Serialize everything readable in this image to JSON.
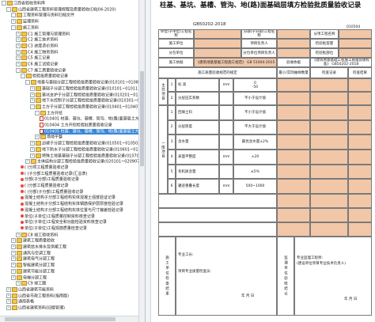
{
  "tree": {
    "items": [
      {
        "label": "江西省验收资料库",
        "indent": 0,
        "icon": "folder",
        "toggle": "-"
      },
      {
        "label": "山西省建筑工程资料管理规程及质量验收(DBJ04-2020)",
        "indent": 1,
        "icon": "folder",
        "toggle": "-"
      },
      {
        "label": "工程资料管理与资料归档文件",
        "indent": 2,
        "icon": "folder",
        "toggle": "-"
      },
      {
        "label": "监理资料",
        "indent": 2,
        "icon": "folder",
        "toggle": "+"
      },
      {
        "label": "施工资料",
        "indent": 2,
        "icon": "folder",
        "toggle": "-"
      },
      {
        "label": "C1 施工管理与管理资料",
        "indent": 3,
        "icon": "folder",
        "toggle": "+"
      },
      {
        "label": "C2 施工技术资料",
        "indent": 3,
        "icon": "folder",
        "toggle": "+"
      },
      {
        "label": "C3 进度造价资料",
        "indent": 3,
        "icon": "folder",
        "toggle": "+"
      },
      {
        "label": "C4 施工物资资料",
        "indent": 3,
        "icon": "folder",
        "toggle": "+"
      },
      {
        "label": "C5 施工记录",
        "indent": 3,
        "icon": "folder",
        "toggle": "+"
      },
      {
        "label": "C6 施工试验记录",
        "indent": 3,
        "icon": "folder",
        "toggle": "+"
      },
      {
        "label": "C7 施工质量验收记录",
        "indent": 3,
        "icon": "folder",
        "toggle": "-"
      },
      {
        "label": "检验批质量验收记录",
        "indent": 4,
        "icon": "folder",
        "toggle": "-"
      },
      {
        "label": "地基与基础分部工程检验批质量验收记录(010101~010801)",
        "indent": 5,
        "icon": "folder",
        "toggle": "-"
      },
      {
        "label": "基础子分部工程检验批质量验收记录(010101~010113)",
        "indent": 6,
        "icon": "folder",
        "toggle": "+"
      },
      {
        "label": "基坑支护子分部工程检验批质量验收记录(010201~010211)",
        "indent": 6,
        "icon": "folder",
        "toggle": "+"
      },
      {
        "label": "地下水控制子分部工程检验批质量验收记录(010301~010303)",
        "indent": 6,
        "icon": "folder",
        "toggle": "+"
      },
      {
        "label": "土方子分部工程检验批质量验收记录(010401~010407)",
        "indent": 6,
        "icon": "folder",
        "toggle": "-"
      },
      {
        "label": "土方开挖",
        "indent": 7,
        "icon": "folder",
        "toggle": "-"
      },
      {
        "label": "010401 柱基、基坑、基槽、管沟、地(路)面基层土方开挖检验批质量验收记录",
        "indent": 8,
        "icon": "pdf",
        "toggle": "",
        "selected": false
      },
      {
        "label": "010404 土方开挖检验批质量验收记录",
        "indent": 8,
        "icon": "pdf",
        "toggle": ""
      },
      {
        "label": "010405 柱基、基坑、基槽、管沟、地(路)面基层土方回填检验批质量验收记录",
        "indent": 8,
        "icon": "pdf",
        "toggle": "",
        "selected": true
      },
      {
        "label": "场地平整",
        "indent": 7,
        "icon": "folder",
        "toggle": "+"
      },
      {
        "label": "边坡子分部工程检验批质量验收记录(010501~010502)",
        "indent": 6,
        "icon": "folder",
        "toggle": "+"
      },
      {
        "label": "地下防水子分部工程检验批质量验收记录(010601~010619)",
        "indent": 6,
        "icon": "folder",
        "toggle": "+"
      },
      {
        "label": "特殊土地基基础子分部工程检验批质量验收记录(010701~010707)",
        "indent": 6,
        "icon": "folder",
        "toggle": "+"
      },
      {
        "label": "主体结构分部工程检验批质量验收记录(020101~020907)",
        "indent": 5,
        "icon": "folder",
        "toggle": "+"
      },
      {
        "label": "(    )分项工程质量验收记录",
        "indent": 4,
        "icon": "excl",
        "toggle": ""
      },
      {
        "label": "(    )子分部工程质量验收记录(汇总表)",
        "indent": 4,
        "icon": "excl",
        "toggle": ""
      },
      {
        "label": "分部(子分部)工程质量验收记录",
        "indent": 4,
        "icon": "excl",
        "toggle": ""
      },
      {
        "label": "(    )分部工程质量验收记录",
        "indent": 4,
        "icon": "excl",
        "toggle": ""
      },
      {
        "label": "(    )分部(子分部)工程质量验收记录",
        "indent": 4,
        "icon": "excl",
        "toggle": ""
      },
      {
        "label": "混凝土结构子分部工程结构实体混凝土强度验证记录",
        "indent": 4,
        "icon": "excl",
        "toggle": ""
      },
      {
        "label": "混凝土结构子分部工程结构实体钢筋保护层厚度检验记录",
        "indent": 4,
        "icon": "excl",
        "toggle": ""
      },
      {
        "label": "混凝土结构子分部工程结构实体位置与尺寸偏差检验记录",
        "indent": 4,
        "icon": "excl",
        "toggle": ""
      },
      {
        "label": "单位(子单位)工程质量控制资料核查记录",
        "indent": 4,
        "icon": "excl",
        "toggle": ""
      },
      {
        "label": "单位(子单位)工程安全和功能检验资料核查记录",
        "indent": 4,
        "icon": "excl",
        "toggle": ""
      },
      {
        "label": "单位(子单位)工程观感质量检查记录",
        "indent": 4,
        "icon": "excl",
        "toggle": ""
      },
      {
        "label": "C8 竣工验收资料",
        "indent": 3,
        "icon": "folder",
        "toggle": "+"
      },
      {
        "label": "建筑工程质量验收",
        "indent": 2,
        "icon": "folder",
        "toggle": "+"
      },
      {
        "label": "建筑给水排水及供暖工程",
        "indent": 2,
        "icon": "folder",
        "toggle": "+"
      },
      {
        "label": "通风与空调工程",
        "indent": 2,
        "icon": "folder",
        "toggle": "+"
      },
      {
        "label": "建筑电气分部工程",
        "indent": 2,
        "icon": "folder",
        "toggle": "+"
      },
      {
        "label": "智能建筑分部工程",
        "indent": 2,
        "icon": "folder",
        "toggle": "+"
      },
      {
        "label": "建筑节能分部工程",
        "indent": 2,
        "icon": "folder",
        "toggle": "+"
      },
      {
        "label": "电梯分部工程",
        "indent": 2,
        "icon": "folder",
        "toggle": "+"
      },
      {
        "label": "C9 竣工图",
        "indent": 3,
        "icon": "folder",
        "toggle": "+"
      },
      {
        "label": "山西省建筑节能资料",
        "indent": 1,
        "icon": "folder",
        "toggle": "+"
      },
      {
        "label": "山西省市政工程资料(指南版)",
        "indent": 1,
        "icon": "folder",
        "toggle": "+"
      },
      {
        "label": "通用表格",
        "indent": 1,
        "icon": "folder",
        "toggle": "+"
      },
      {
        "label": "山西省建筑资料(旧版管理)",
        "indent": 1,
        "icon": "folder",
        "toggle": "+"
      }
    ]
  },
  "doc": {
    "title": "柱基、基坑、基槽、管沟、地(路)面基础层填方检验批质量验收记录",
    "standard": "GB50202-2018",
    "code": "010504",
    "header": {
      "unit_project": "单位(子单位)工程名称",
      "sub_project": "分部(子分部)工程名称",
      "item_project": "分项工程名称",
      "construction_unit": "施工单位",
      "project_manager": "项目负责人",
      "inspection_capacity": "检验批容量",
      "subcontract_unit": "分包单位",
      "subcontract_manager": "分包单位项目负责人",
      "inspection_part": "检验批部位",
      "construction_basis": "施工依据",
      "basis_value": "《建筑地基基础工程施工规范》 GB 51004-2015",
      "acceptance_basis": "验收依据",
      "acceptance_value": "《建筑地基基础工程施工质量验收标准》 GB50202-2018"
    },
    "columns": {
      "items": "施工质量验收规范的规定",
      "min_sampling": "最小/实际抽样数量",
      "check_record": "检查记录",
      "check_result": "检查结果"
    },
    "main_label": "主控项目",
    "general_label": "一般项目",
    "main_items": [
      {
        "no": "1",
        "name": "标 高",
        "unit": "mm",
        "std": "0\n-50"
      },
      {
        "no": "2",
        "name": "分层压实系数",
        "unit": "",
        "std": "不小于设计值"
      }
    ],
    "general_items": [
      {
        "no": "1",
        "name": "回填土料",
        "unit": "",
        "std": "不小于设计值"
      },
      {
        "no": "2",
        "name": "分层厚度",
        "unit": "",
        "std": "不大于设计值"
      },
      {
        "no": "3",
        "name": "含水量",
        "unit": "",
        "std": "最优含水量±2%"
      },
      {
        "no": "4",
        "name": "表面平整度",
        "unit": "mm",
        "std": "±20"
      },
      {
        "no": "5",
        "name": "有机质含量",
        "unit": "",
        "std": "≤5%"
      },
      {
        "no": "6",
        "name": "辗迹重叠长度",
        "unit": "mm",
        "std": "500~1000"
      }
    ],
    "footer": {
      "construction_check": "施工单位检查结果",
      "supervision_conclusion": "监理单位验收结论",
      "professional_foreman": "专业工长:",
      "quality_inspector": "项目专业质量检查员:",
      "date": "年  月  日",
      "supervision_engineer": "专业监理工程师:",
      "owner_rep": "(建设单位项目专业技术负责人)"
    }
  }
}
